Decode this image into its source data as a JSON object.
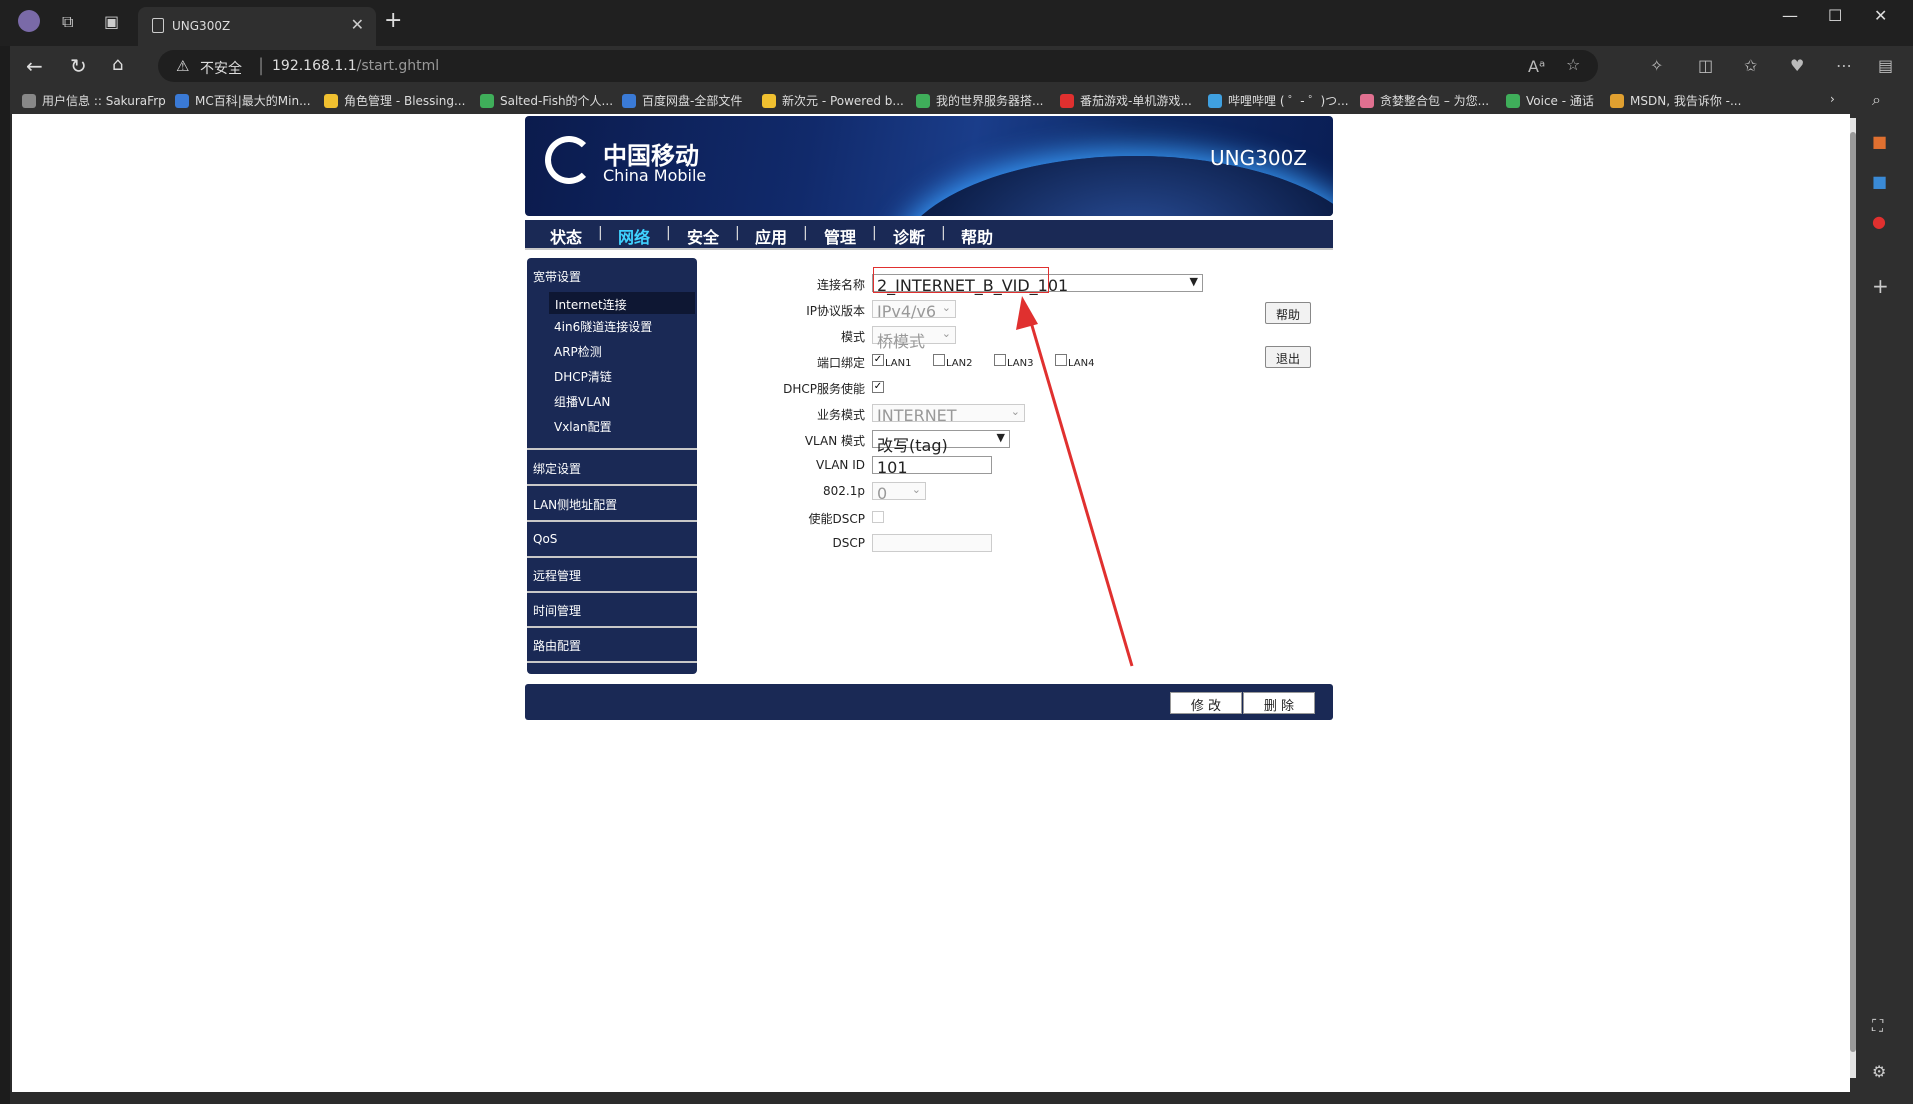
{
  "browser": {
    "tab_title": "UNG300Z",
    "address": {
      "security_label": "不安全",
      "host": "192.168.1.1",
      "path": "/start.ghtml"
    },
    "bookmarks": [
      {
        "label": "用户信息 :: SakuraFrp",
        "color": "#888888"
      },
      {
        "label": "MC百科|最大的Min...",
        "color": "#3a7ad6"
      },
      {
        "label": "角色管理 - Blessing...",
        "color": "#f0c030"
      },
      {
        "label": "Salted-Fish的个人...",
        "color": "#3fae5a"
      },
      {
        "label": "百度网盘-全部文件",
        "color": "#3a7ad6"
      },
      {
        "label": "新次元 - Powered b...",
        "color": "#f0c030"
      },
      {
        "label": "我的世界服务器搭...",
        "color": "#3fae5a"
      },
      {
        "label": "番茄游戏-单机游戏...",
        "color": "#e0302f"
      },
      {
        "label": "哔哩哔哩 ( ゜- ゜)つ...",
        "color": "#3fa0e0"
      },
      {
        "label": "贪婪整合包 – 为您...",
        "color": "#e07090"
      },
      {
        "label": "Voice - 通话",
        "color": "#3fae5a"
      },
      {
        "label": "MSDN, 我告诉你 -...",
        "color": "#e0a030"
      }
    ]
  },
  "header": {
    "brand_cn": "中国移动",
    "brand_en": "China Mobile",
    "model": "UNG300Z"
  },
  "menu": {
    "items": [
      "状态",
      "网络",
      "安全",
      "应用",
      "管理",
      "诊断",
      "帮助"
    ],
    "active": "网络"
  },
  "leftnav": {
    "group1": "宽带设置",
    "sub_items": [
      "Internet连接",
      "4in6隧道连接设置",
      "ARP检测",
      "DHCP清链",
      "组播VLAN",
      "Vxlan配置"
    ],
    "groups": [
      "绑定设置",
      "LAN侧地址配置",
      "QoS",
      "远程管理",
      "时间管理",
      "路由配置"
    ]
  },
  "form": {
    "conn_name": {
      "label": "连接名称",
      "value": "2_INTERNET_B_VID_101"
    },
    "ip_version": {
      "label": "IP协议版本",
      "value": "IPv4/v6"
    },
    "mode": {
      "label": "模式",
      "value": "桥模式"
    },
    "port_bind": {
      "label": "端口绑定",
      "ports": [
        "LAN1",
        "LAN2",
        "LAN3",
        "LAN4"
      ],
      "checked": [
        true,
        false,
        false,
        false
      ]
    },
    "dhcp": {
      "label": "DHCP服务使能",
      "checked": true
    },
    "service_mode": {
      "label": "业务模式",
      "value": "INTERNET"
    },
    "vlan_mode": {
      "label": "VLAN 模式",
      "value": "改写(tag)"
    },
    "vlan_id": {
      "label": "VLAN ID",
      "value": "101"
    },
    "p8021": {
      "label": "802.1p",
      "value": "0"
    },
    "dscp_enable": {
      "label": "使能DSCP"
    },
    "dscp": {
      "label": "DSCP",
      "value": ""
    }
  },
  "buttons": {
    "help": "帮助",
    "logout": "退出",
    "modify": "修 改",
    "delete": "删 除"
  },
  "colors": {
    "nav_bg": "#1a2955",
    "active_menu": "#3fd2ff",
    "annotation": "#e0302f"
  }
}
